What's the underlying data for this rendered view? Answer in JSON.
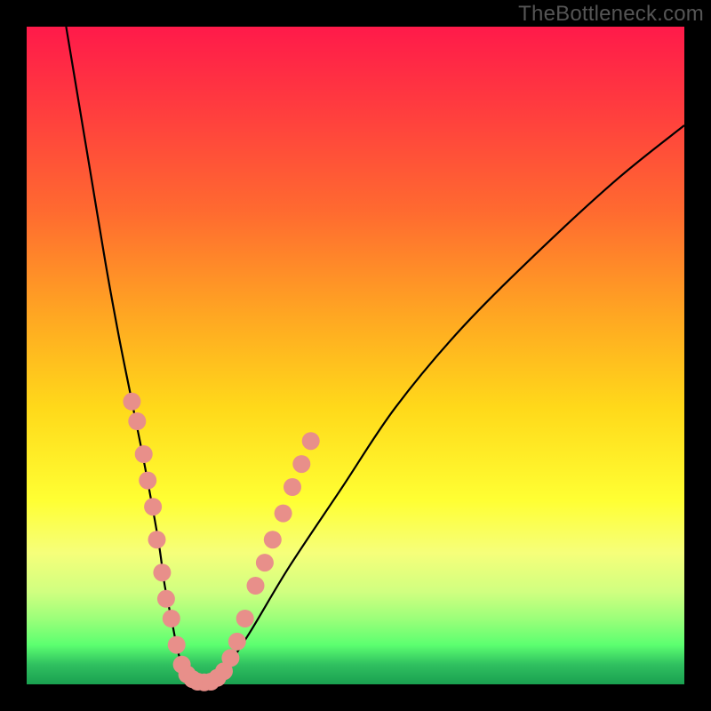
{
  "watermark": "TheBottleneck.com",
  "colors": {
    "frame": "#000000",
    "gradient_top": "#ff1a4a",
    "gradient_bottom": "#1aa050",
    "curve": "#000000",
    "dot": "#e88f8a"
  },
  "chart_data": {
    "type": "line",
    "title": "",
    "xlabel": "",
    "ylabel": "",
    "xlim": [
      0,
      100
    ],
    "ylim": [
      0,
      100
    ],
    "series": [
      {
        "name": "bottleneck-curve",
        "x": [
          6,
          8,
          10,
          12,
          14,
          16,
          18,
          20,
          21,
          22,
          23,
          24,
          25,
          26,
          28,
          30,
          34,
          40,
          48,
          56,
          66,
          78,
          90,
          100
        ],
        "y": [
          100,
          88,
          76,
          64,
          53,
          43,
          33,
          22,
          15,
          10,
          5,
          2,
          1,
          0,
          0,
          2,
          8,
          18,
          30,
          42,
          54,
          66,
          77,
          85
        ]
      }
    ],
    "markers": {
      "name": "highlighted-points",
      "points": [
        {
          "x": 16.0,
          "y": 43
        },
        {
          "x": 16.8,
          "y": 40
        },
        {
          "x": 17.8,
          "y": 35
        },
        {
          "x": 18.4,
          "y": 31
        },
        {
          "x": 19.2,
          "y": 27
        },
        {
          "x": 19.8,
          "y": 22
        },
        {
          "x": 20.6,
          "y": 17
        },
        {
          "x": 21.2,
          "y": 13
        },
        {
          "x": 22.0,
          "y": 10
        },
        {
          "x": 22.8,
          "y": 6
        },
        {
          "x": 23.6,
          "y": 3
        },
        {
          "x": 24.4,
          "y": 1.5
        },
        {
          "x": 25.2,
          "y": 0.8
        },
        {
          "x": 26.0,
          "y": 0.4
        },
        {
          "x": 27.0,
          "y": 0.3
        },
        {
          "x": 28.0,
          "y": 0.4
        },
        {
          "x": 29.0,
          "y": 1.0
        },
        {
          "x": 30.0,
          "y": 2.0
        },
        {
          "x": 31.0,
          "y": 4.0
        },
        {
          "x": 32.0,
          "y": 6.5
        },
        {
          "x": 33.2,
          "y": 10.0
        },
        {
          "x": 34.8,
          "y": 15.0
        },
        {
          "x": 36.2,
          "y": 18.5
        },
        {
          "x": 37.4,
          "y": 22.0
        },
        {
          "x": 39.0,
          "y": 26.0
        },
        {
          "x": 40.4,
          "y": 30.0
        },
        {
          "x": 41.8,
          "y": 33.5
        },
        {
          "x": 43.2,
          "y": 37.0
        }
      ]
    }
  }
}
